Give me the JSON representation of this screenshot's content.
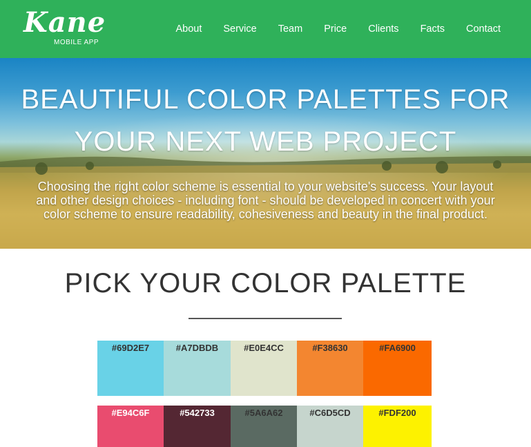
{
  "brand": {
    "name": "Kane",
    "tagline": "MOBILE APP"
  },
  "nav": {
    "items": [
      {
        "label": "About"
      },
      {
        "label": "Service"
      },
      {
        "label": "Team"
      },
      {
        "label": "Price"
      },
      {
        "label": "Clients"
      },
      {
        "label": "Facts"
      },
      {
        "label": "Contact"
      }
    ]
  },
  "hero": {
    "title_line1": "BEAUTIFUL COLOR PALETTES FOR",
    "title_line2": "YOUR NEXT WEB PROJECT",
    "text": "Choosing the right color scheme is essential to your website's success. Your layout and other design choices - including font - should be developed in concert with your color scheme to ensure readability, cohesiveness and beauty in the final product."
  },
  "section": {
    "title": "PICK YOUR COLOR PALETTE"
  },
  "colors": {
    "nav_bg": "#2fb15a"
  },
  "palettes": [
    {
      "swatches": [
        {
          "label": "#69D2E7",
          "color": "#69D2E7",
          "text_color": "#333333"
        },
        {
          "label": "#A7DBDB",
          "color": "#A7DBDB",
          "text_color": "#333333"
        },
        {
          "label": "#E0E4CC",
          "color": "#E0E4CC",
          "text_color": "#333333"
        },
        {
          "label": "#F38630",
          "color": "#F38630",
          "text_color": "#333333"
        },
        {
          "label": "#FA6900",
          "color": "#FA6900",
          "text_color": "#333333"
        }
      ]
    },
    {
      "swatches": [
        {
          "label": "#E94C6F",
          "color": "#E94C6F",
          "text_color": "#ffffff"
        },
        {
          "label": "#542733",
          "color": "#542733",
          "text_color": "#ffffff"
        },
        {
          "label": "#5A6A62",
          "color": "#5A6A62",
          "text_color": "#333333"
        },
        {
          "label": "#C6D5CD",
          "color": "#C6D5CD",
          "text_color": "#333333"
        },
        {
          "label": "#FDF200",
          "color": "#FDF200",
          "text_color": "#333333"
        }
      ]
    }
  ]
}
